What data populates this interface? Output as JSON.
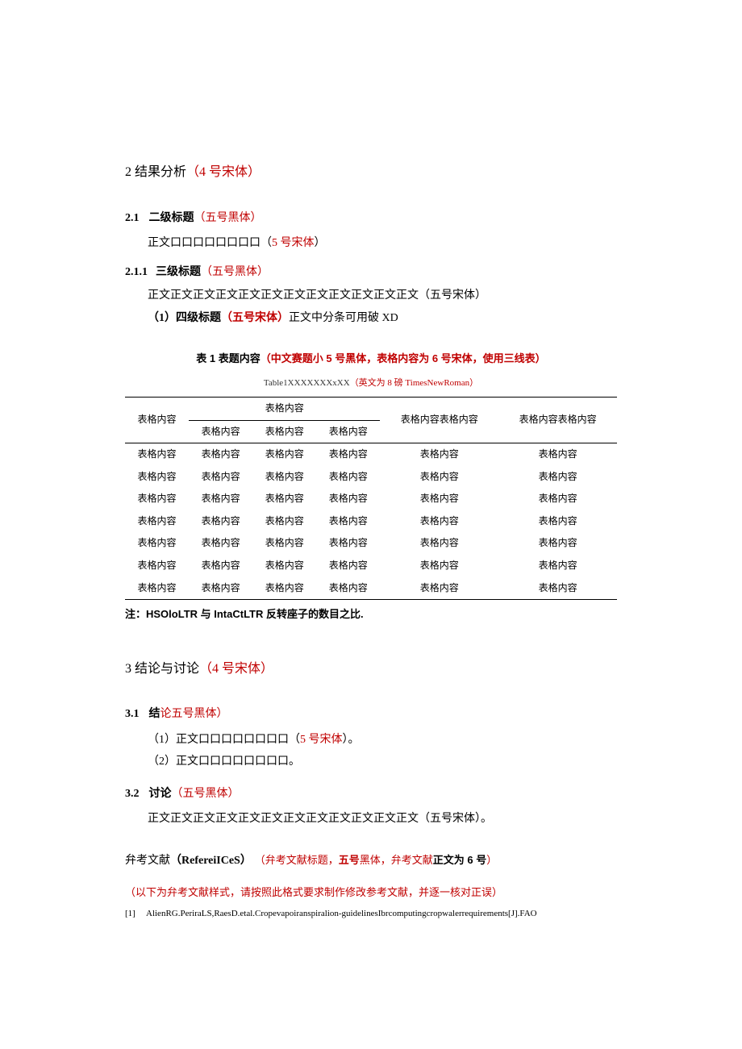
{
  "s2": {
    "title_num": "2",
    "title_text": " 结果分析",
    "title_hint": "（4 号宋体）",
    "h2_1_num": "2.1",
    "h2_1_text": "二级标题",
    "h2_1_hint": "（五号黑体）",
    "body_1a": "正文口口口口口口口口（",
    "body_1b": "5 号宋体",
    "body_1c": "）",
    "h3_1_num": "2.1.1",
    "h3_1_text": "三级标题",
    "h3_1_hint": "（五号黑体）",
    "body_2": "正文正文正文正文正文正文正文正文正文正文正文正文（五号宋体）",
    "body_3a": "（1）四级标题",
    "body_3b": "（五号宋体）",
    "body_3c": "正文中分条可用破 XD"
  },
  "table": {
    "title_a": "表 1 表题内容",
    "title_b": "（中文赛题小 5 号黑体，表格内容为 6 号宋体，使用三线表）",
    "title_en_a": "Table1XXXXXXXxXX",
    "title_en_b": "（英文为 8 磅 TimesNewRoman）",
    "col1_head": "表格内容",
    "col_group_head": "表格内容",
    "sub1": "表格内容",
    "sub2": "表格内容",
    "sub3": "表格内容",
    "col5_head": "表格内容表格内容",
    "col6_head": "表格内容表格内容",
    "cell": "表格内容",
    "note": "注：HSOloLTR 与 IntaCtLTR 反转座子的数目之比."
  },
  "s3": {
    "title_num": "3",
    "title_text": " 结论与讨论",
    "title_hint": "（4 号宋体）",
    "h2_1_num": "3.1",
    "h2_1_text_a": "结",
    "h2_1_text_b": "论五号黑体）",
    "body_1a": "（1）正文口口口口口口口口（",
    "body_1b": "5 号宋体",
    "body_1c": "）。",
    "body_2": "（2）正文口口口口口口口口。",
    "h2_2_num": "3.2",
    "h2_2_text": "讨论",
    "h2_2_hint": "（五号黑体）",
    "body_3": "正文正文正文正文正文正文正文正文正文正文正文正文（五号宋体）。"
  },
  "refs": {
    "title_a": "弁考文献",
    "title_b": "（RefereiICeS）",
    "title_c": "（弁考文献标题，",
    "title_d": "五号",
    "title_e": "黑体，弁考文献",
    "title_f": "正文为 6 号",
    "title_g": "）",
    "note": "（以下为弁考文献样式，请按照此格式要求制作修改参考文献，并逐一核对正误）",
    "item1_num": "[1]",
    "item1_text": "AlienRG.PeriraLS,RaesD.etal.Cropevapoiranspiralion-guidelinesIbrcomputingcropwalerrequirements[J].FAO"
  }
}
